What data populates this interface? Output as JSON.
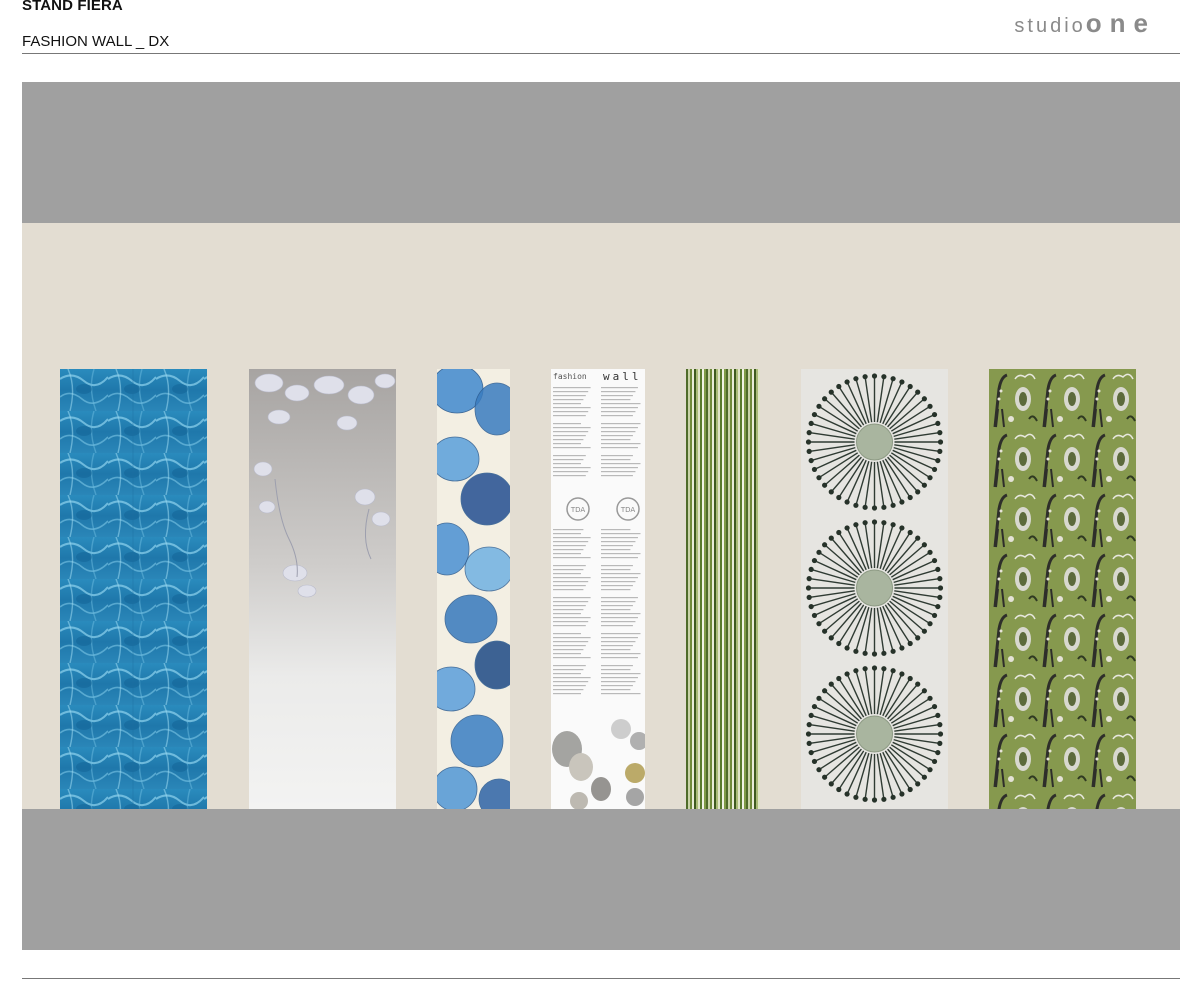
{
  "header": {
    "title": "STAND FIERA",
    "subtitle": "FASHION WALL _ DX",
    "logo_word": "studio",
    "logo_mark": "one"
  },
  "panel_text": {
    "brand_a": "fashion",
    "brand_b": "wall",
    "badge": "TDA"
  },
  "colors": {
    "band": "#a0a0a0",
    "wall": "#e3ddd2",
    "rule": "#777777",
    "logo": "#8a8a8a"
  },
  "panels": [
    {
      "name": "blue-water-caustics"
    },
    {
      "name": "grey-magnolia-fade"
    },
    {
      "name": "blue-leaves"
    },
    {
      "name": "fashion-wall-brochure"
    },
    {
      "name": "green-stripes"
    },
    {
      "name": "radial-sunburst-discs"
    },
    {
      "name": "green-giraffe-jungle"
    }
  ]
}
